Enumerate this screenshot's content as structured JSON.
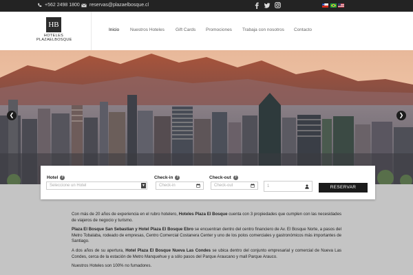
{
  "topbar": {
    "phone": "+562 2498 1800",
    "email": "reservas@plazaelbosque.cl",
    "social": [
      "facebook-icon",
      "twitter-icon",
      "instagram-icon"
    ],
    "languages": [
      "chile-flag",
      "brazil-flag",
      "usa-flag"
    ]
  },
  "logo": {
    "mark": "HB",
    "line1": "HOTELES",
    "line2": "PLAZAELBOSQUE"
  },
  "nav": {
    "items": [
      "Inicio",
      "Nuestros Hoteles",
      "Gift Cards",
      "Promociones",
      "Trabaja con nosotros",
      "Contacto"
    ],
    "active": "Inicio"
  },
  "booking": {
    "hotel_label": "Hotel",
    "hotel_placeholder": "Seleccione un Hotel",
    "checkin_label": "Check-in",
    "checkin_placeholder": "Check-in",
    "checkout_label": "Check-out",
    "checkout_placeholder": "Check-out",
    "guests_value": "1",
    "button_label": "RESERVAR"
  },
  "content": {
    "p1_a": "Con más de 20 años de experiencia en el rubro hotelero, ",
    "p1_b": "Hoteles Plaza El Bosque",
    "p1_c": " cuenta con 3 propiedades que cumplen con las necesidades de viajeros de negocio y turismo.",
    "p2_a": "Plaza El Bosque San Sebastian y Hotel Plaza El Bosque Ebro",
    "p2_b": " se encuentran dentro del centro financiero de Av. El Bosque Norte, a pasos del Metro Tobalaba, rodeado de empresas, Centro Comercial Costanera Center y uno de los polos comerciales y gastronómicos más importantes de Santiago.",
    "p3_a": "A dos años de su apertura, ",
    "p3_b": "Hotel Plaza El Bosque Nueva Las Condes",
    "p3_c": " se ubica dentro del conjunto empresarial y comercial de Nueva Las Condes, cerca de la estación de Metro Manquehue y a sólo pasos del Parque Araucano y mall Parque Arauco.",
    "p4": "Nuestros Hoteles son 100% no fumadores."
  },
  "colors": {
    "topbar": "#232323",
    "button": "#1b1b1b",
    "footer_bg": "#c4c4c4"
  }
}
